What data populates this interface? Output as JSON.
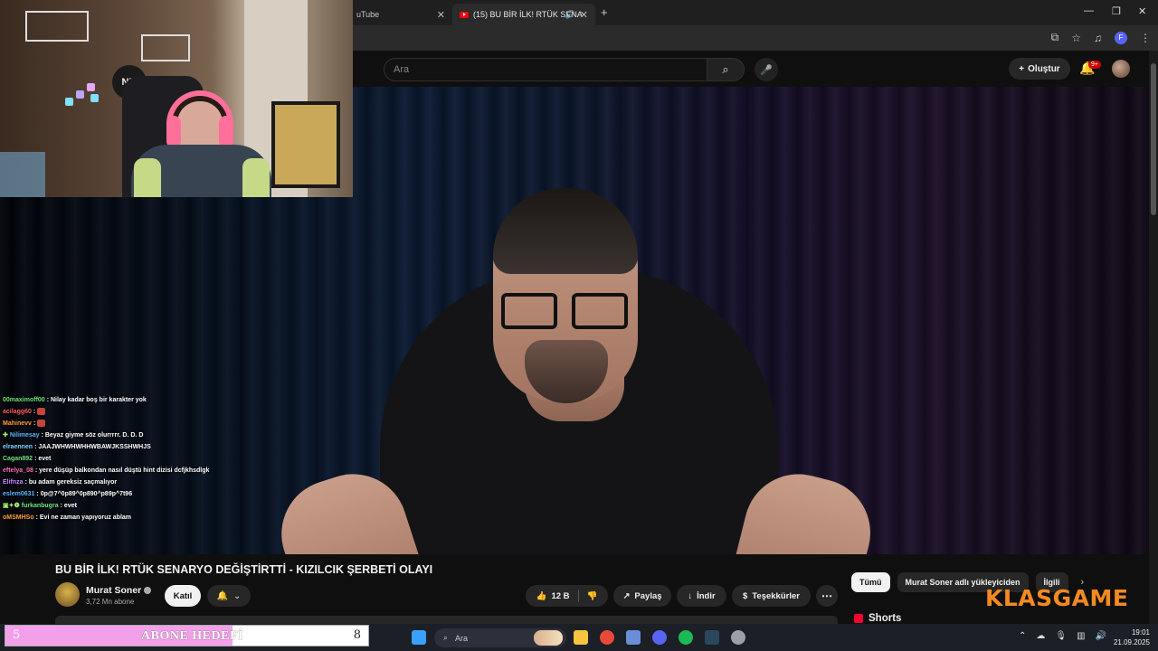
{
  "browser": {
    "tabs": [
      {
        "label": "uTube"
      },
      {
        "label": "(15) BU BİR İLK! RTÜK SENA"
      }
    ],
    "new_tab": "+",
    "window_controls": [
      "—",
      "❐",
      "✕"
    ]
  },
  "youtube": {
    "search_placeholder": "Ara",
    "create_label": "Oluştur",
    "notification_count": "9+"
  },
  "webcam": {
    "logo_text": "NM"
  },
  "chat": [
    {
      "user": "00maximoff00",
      "user_color": "#6fe37a",
      "message": ": Nilay kadar boş bir karakter yok"
    },
    {
      "user": "acilagg60",
      "user_color": "#ff5a5a",
      "message": ": ",
      "emote": true
    },
    {
      "user": "Mahinevv",
      "user_color": "#ff9f3a",
      "message": ": ",
      "emote": true
    },
    {
      "user": "Nilimesay",
      "user_color": "#59b6ff",
      "message": ": Beyaz giyme söz olurrrrr. D. D. D",
      "badge": "✚"
    },
    {
      "user": "elraennen",
      "user_color": "#7fd3ff",
      "message": ": JAAJWHWHWHHWBAWJKSSHWHJS"
    },
    {
      "user": "Cagan892",
      "user_color": "#6fe37a",
      "message": ": evet"
    },
    {
      "user": "eftelya_08",
      "user_color": "#ff6fb3",
      "message": ": yere düşüp balkondan nasıl düştü hint dizisi dcfjkhsdlgk"
    },
    {
      "user": "Elifnza",
      "user_color": "#c58cff",
      "message": ": bu adam gereksiz saçmalıyor"
    },
    {
      "user": "eslem0631",
      "user_color": "#59b6ff",
      "message": ": 0p@7^0p89^0p890^p89p^7t96"
    },
    {
      "user": "furkanbugra",
      "user_color": "#6fe37a",
      "message": ": evet",
      "badge": "▣✦❶"
    },
    {
      "user": "oMSMHSo",
      "user_color": "#ff9f3a",
      "message": ": Evi ne zaman yapıyoruz ablam"
    }
  ],
  "video": {
    "title": "BU BİR İLK! RTÜK SENARYO DEĞİŞTİRTTİ - KIZILCIK ŞERBETİ OLAYI",
    "channel_name": "Murat Soner",
    "subscribers": "3,72 Mn abone",
    "join_label": "Katıl",
    "likes": "12 B",
    "share_label": "Paylaş",
    "download_label": "İndir",
    "thanks_label": "Teşekkürler",
    "more_label": "⋯"
  },
  "sidebar": {
    "chips": [
      {
        "label": "Tümü",
        "active": true
      },
      {
        "label": "Murat Soner adlı yükleyiciden",
        "active": false
      },
      {
        "label": "İlgili",
        "active": false
      }
    ],
    "shorts_label": "Shorts"
  },
  "sponsor": {
    "logo_text": "KLASGAME"
  },
  "goal": {
    "current": "5",
    "label": "ABONE HEDEFİ",
    "target": "8",
    "progress": 0.625
  },
  "taskbar": {
    "search_label": "Ara",
    "time": "19:01",
    "date": "21.09.2025"
  },
  "colors": {
    "brand_red": "#ff0000",
    "sponsor_orange": "#f38a1f",
    "goal_pink": "#f3a0ea"
  }
}
